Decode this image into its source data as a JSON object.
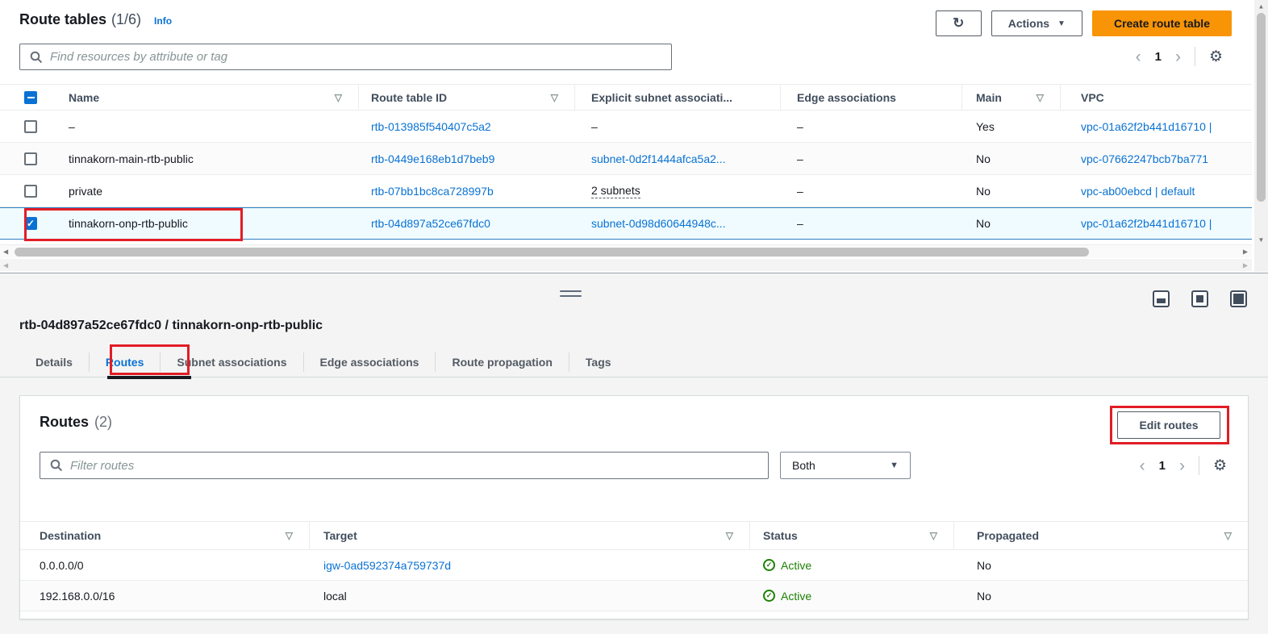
{
  "header": {
    "title": "Route tables",
    "count": "(1/6)",
    "info_label": "Info",
    "actions_label": "Actions",
    "create_label": "Create route table",
    "search_placeholder": "Find resources by attribute or tag"
  },
  "route_tables": {
    "columns": [
      {
        "label": "Name",
        "sortable": true
      },
      {
        "label": "Route table ID",
        "sortable": true
      },
      {
        "label": "Explicit subnet associati...",
        "sortable": false
      },
      {
        "label": "Edge associations",
        "sortable": false
      },
      {
        "label": "Main",
        "sortable": true
      },
      {
        "label": "VPC",
        "sortable": false
      }
    ],
    "rows": [
      {
        "selected": false,
        "name": "–",
        "route_table_id": "rtb-013985f540407c5a2",
        "explicit_subnet_associations": "–",
        "subnet_style": "plain",
        "edge_associations": "–",
        "main": "Yes",
        "vpc": "vpc-01a62f2b441d16710 |"
      },
      {
        "selected": false,
        "name": "tinnakorn-main-rtb-public",
        "route_table_id": "rtb-0449e168eb1d7beb9",
        "explicit_subnet_associations": "subnet-0d2f1444afca5a2...",
        "subnet_style": "link",
        "edge_associations": "–",
        "main": "No",
        "vpc": "vpc-07662247bcb7ba771"
      },
      {
        "selected": false,
        "name": "private",
        "route_table_id": "rtb-07bb1bc8ca728997b",
        "explicit_subnet_associations": "2 subnets",
        "subnet_style": "dashed",
        "edge_associations": "–",
        "main": "No",
        "vpc": "vpc-ab00ebcd | default"
      },
      {
        "selected": true,
        "name": "tinnakorn-onp-rtb-public",
        "route_table_id": "rtb-04d897a52ce67fdc0",
        "explicit_subnet_associations": "subnet-0d98d60644948c...",
        "subnet_style": "link",
        "edge_associations": "–",
        "main": "No",
        "vpc": "vpc-01a62f2b441d16710 |"
      }
    ],
    "pagination": {
      "page": "1"
    }
  },
  "split_panel": {
    "title": "rtb-04d897a52ce67fdc0 / tinnakorn-onp-rtb-public",
    "tabs": [
      {
        "label": "Details",
        "active": false
      },
      {
        "label": "Routes",
        "active": true,
        "annotated": true
      },
      {
        "label": "Subnet associations",
        "active": false
      },
      {
        "label": "Edge associations",
        "active": false
      },
      {
        "label": "Route propagation",
        "active": false
      },
      {
        "label": "Tags",
        "active": false
      }
    ],
    "routes_panel": {
      "title": "Routes",
      "count": "(2)",
      "edit_button_label": "Edit routes",
      "filter_placeholder": "Filter routes",
      "filter_dropdown_value": "Both",
      "page": "1",
      "columns": [
        "Destination",
        "Target",
        "Status",
        "Propagated"
      ],
      "rows": [
        {
          "destination": "0.0.0.0/0",
          "target": "igw-0ad592374a759737d",
          "target_is_link": true,
          "status": "Active",
          "propagated": "No"
        },
        {
          "destination": "192.168.0.0/16",
          "target": "local",
          "target_is_link": false,
          "status": "Active",
          "propagated": "No"
        }
      ]
    }
  },
  "icons": {
    "refresh": "↻",
    "caret_down": "▼",
    "sort": "▽",
    "gear": "⚙",
    "chevron_left": "‹",
    "chevron_right": "›",
    "check": "✓",
    "arrow_up": "▲",
    "arrow_down": "▼",
    "arrow_left": "◀",
    "arrow_right": "▶"
  },
  "colors": {
    "accent_blue": "#0972d3",
    "primary_orange": "#f89406",
    "status_green": "#1d8102",
    "annotation_red": "#e21d25",
    "selected_row_bg": "#f0fbff"
  }
}
